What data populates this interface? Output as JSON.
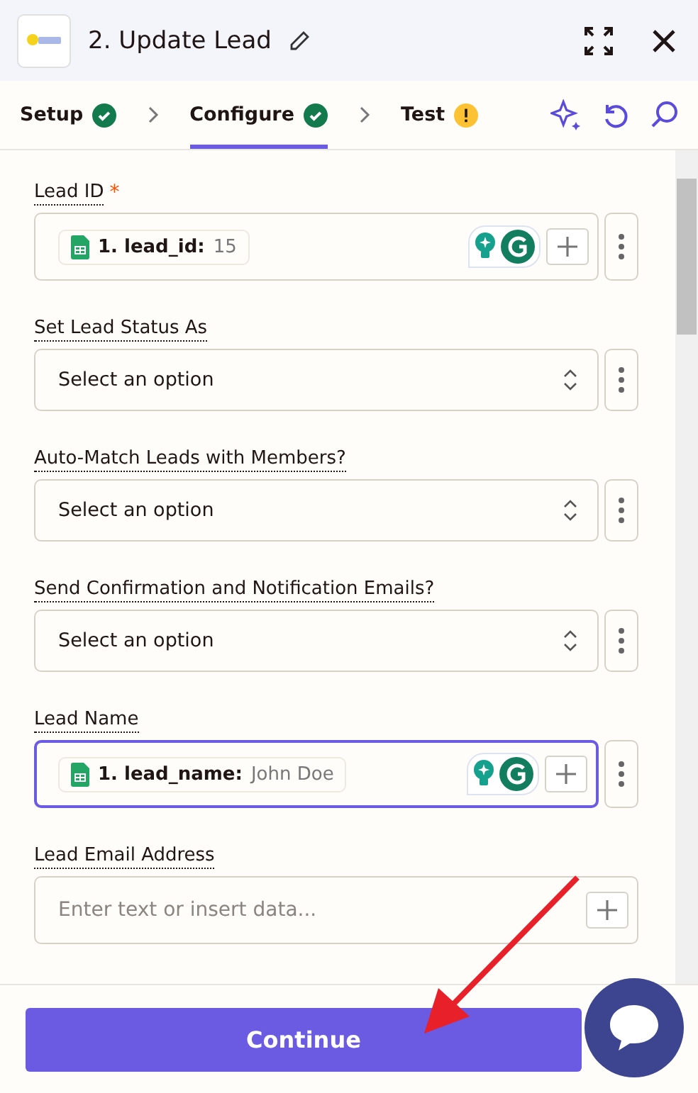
{
  "header": {
    "title": "2. Update Lead"
  },
  "steps": [
    {
      "label": "Setup",
      "kind": "done",
      "selected": false
    },
    {
      "label": "Configure",
      "kind": "done",
      "selected": true
    },
    {
      "label": "Test",
      "kind": "warning",
      "selected": false
    }
  ],
  "fields": [
    {
      "kind": "token",
      "label": "Lead ID",
      "required_mark": "*",
      "focused": false,
      "token_label": "1. lead_id:",
      "token_value": "15"
    },
    {
      "kind": "select",
      "label": "Set Lead Status As",
      "focused": false,
      "value": "Select an option"
    },
    {
      "kind": "select",
      "label": "Auto-Match Leads with Members?",
      "focused": false,
      "value": "Select an option"
    },
    {
      "kind": "select",
      "label": "Send Confirmation and Notification Emails?",
      "focused": false,
      "value": "Select an option"
    },
    {
      "kind": "token",
      "label": "Lead Name",
      "focused": true,
      "token_label": "1. lead_name:",
      "token_value": "John Doe"
    },
    {
      "kind": "text",
      "label": "Lead Email Address",
      "focused": false,
      "placeholder": "Enter text or insert data..."
    }
  ],
  "footer": {
    "button": "Continue"
  }
}
